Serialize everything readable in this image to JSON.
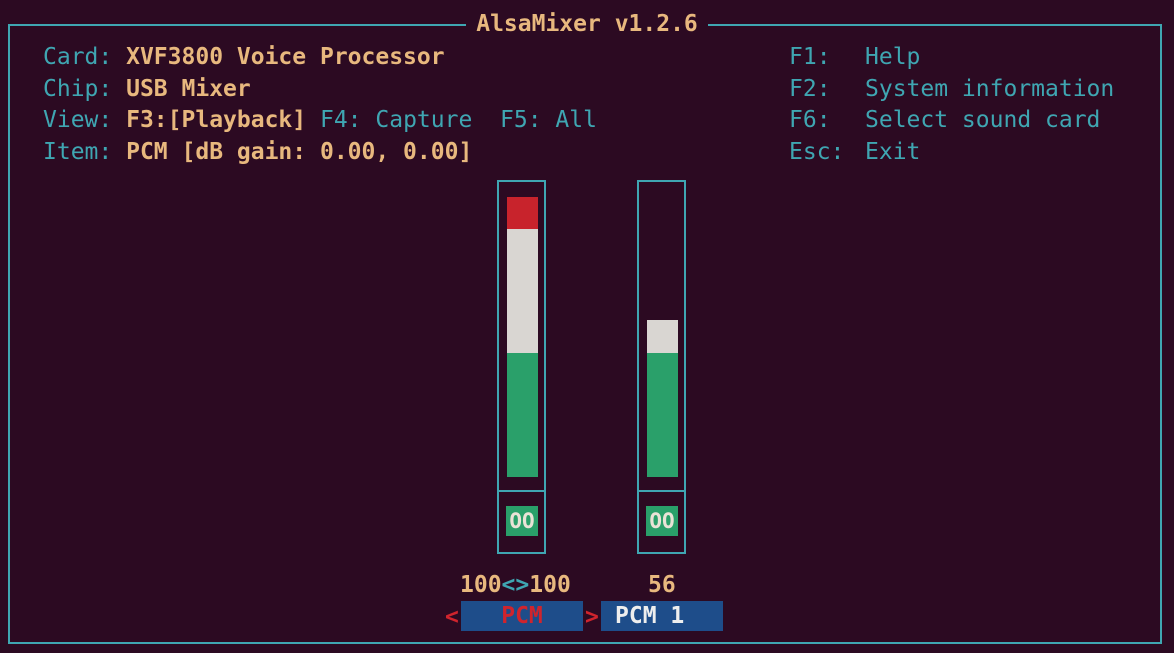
{
  "title": "AlsaMixer v1.2.6",
  "info": {
    "card_label": "Card:",
    "card_value": "XVF3800 Voice Processor",
    "chip_label": "Chip:",
    "chip_value": "USB Mixer",
    "view_label": "View:",
    "view_playback": "F3:[Playback]",
    "view_capture": "F4: Capture",
    "view_all": "F5: All",
    "item_label": "Item:",
    "item_value": "PCM [dB gain: 0.00, 0.00]"
  },
  "help": [
    {
      "key": "F1:",
      "label": "Help"
    },
    {
      "key": "F2:",
      "label": "System information"
    },
    {
      "key": "F6:",
      "label": "Select sound card"
    },
    {
      "key": "Esc:",
      "label": "Exit"
    }
  ],
  "controls": [
    {
      "name": "PCM",
      "selected": true,
      "value_left": "100",
      "value_sep": "<>",
      "value_right": "100",
      "mute_label": "OO",
      "level": 1.0
    },
    {
      "name": "PCM 1",
      "selected": false,
      "value": "56",
      "mute_label": "OO",
      "level": 0.56
    }
  ],
  "arrows": {
    "left": "<",
    "right": ">"
  },
  "colors": {
    "background": "#2c0a22",
    "border": "#3fa6b2",
    "bar_green": "#2aa06a",
    "bar_white": "#d9d6d2",
    "bar_red": "#c8232c",
    "label_bg": "#1e4d8a",
    "value_text": "#e8b87e"
  }
}
